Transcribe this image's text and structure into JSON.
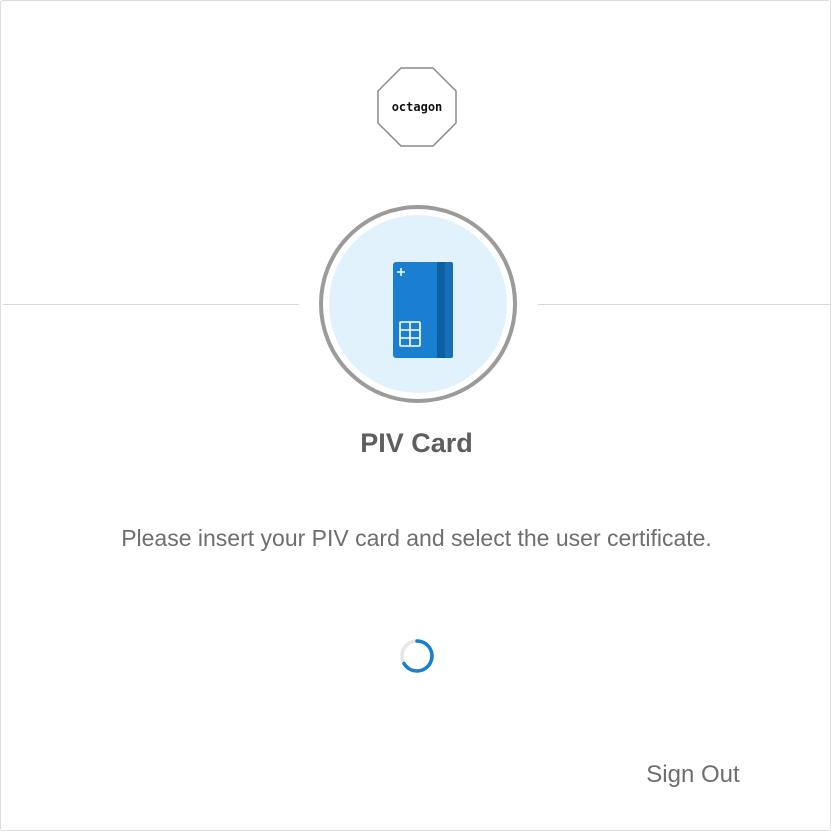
{
  "brand": {
    "logo_text": "octagon"
  },
  "factor": {
    "icon": "piv-card-icon",
    "title": "PIV Card",
    "instructions": "Please insert your PIV card and select the user certificate.",
    "status": "loading-spinner"
  },
  "actions": {
    "sign_out_label": "Sign Out"
  },
  "colors": {
    "card_blue": "#1a7fd0",
    "card_stripe": "#0d5fa3",
    "circle_bg": "#e1f2fc",
    "ring": "#9b9b9b",
    "title_text": "#5e5e5e",
    "body_text": "#6e6e6e"
  }
}
